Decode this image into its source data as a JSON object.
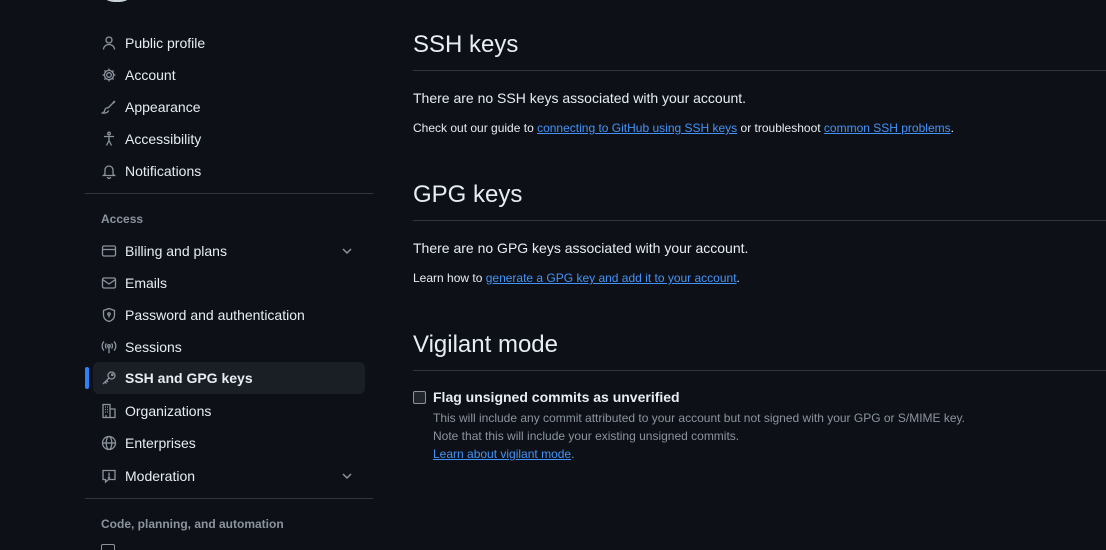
{
  "sidebar": {
    "items": [
      {
        "label": "Public profile",
        "icon": "person-icon"
      },
      {
        "label": "Account",
        "icon": "gear-icon"
      },
      {
        "label": "Appearance",
        "icon": "paintbrush-icon"
      },
      {
        "label": "Accessibility",
        "icon": "accessibility-icon"
      },
      {
        "label": "Notifications",
        "icon": "bell-icon"
      }
    ],
    "access_title": "Access",
    "access_items": [
      {
        "label": "Billing and plans",
        "icon": "credit-card-icon",
        "expandable": true
      },
      {
        "label": "Emails",
        "icon": "mail-icon"
      },
      {
        "label": "Password and authentication",
        "icon": "shield-lock-icon"
      },
      {
        "label": "Sessions",
        "icon": "broadcast-icon"
      },
      {
        "label": "SSH and GPG keys",
        "icon": "key-icon",
        "active": true
      },
      {
        "label": "Organizations",
        "icon": "organization-icon"
      },
      {
        "label": "Enterprises",
        "icon": "globe-icon"
      },
      {
        "label": "Moderation",
        "icon": "report-icon",
        "expandable": true
      }
    ],
    "code_title": "Code, planning, and automation"
  },
  "ssh": {
    "title": "SSH keys",
    "empty": "There are no SSH keys associated with your account.",
    "prefix": "Check out our guide to ",
    "link1": "connecting to GitHub using SSH keys",
    "middle": " or troubleshoot ",
    "link2": "common SSH problems",
    "suffix": "."
  },
  "gpg": {
    "title": "GPG keys",
    "empty": "There are no GPG keys associated with your account.",
    "prefix": "Learn how to ",
    "link": "generate a GPG key and add it to your account",
    "suffix": "."
  },
  "vigilant": {
    "title": "Vigilant mode",
    "checkbox_label": "Flag unsigned commits as unverified",
    "checked": false,
    "desc1": "This will include any commit attributed to your account but not signed with your GPG or S/MIME key.",
    "desc2": "Note that this will include your existing unsigned commits.",
    "link": "Learn about vigilant mode",
    "suffix": "."
  },
  "colors": {
    "background": "#0d1117",
    "text": "#e6edf3",
    "muted": "#8b949e",
    "link": "#4493f8",
    "accent": "#2f81f7",
    "border": "#30363d"
  }
}
